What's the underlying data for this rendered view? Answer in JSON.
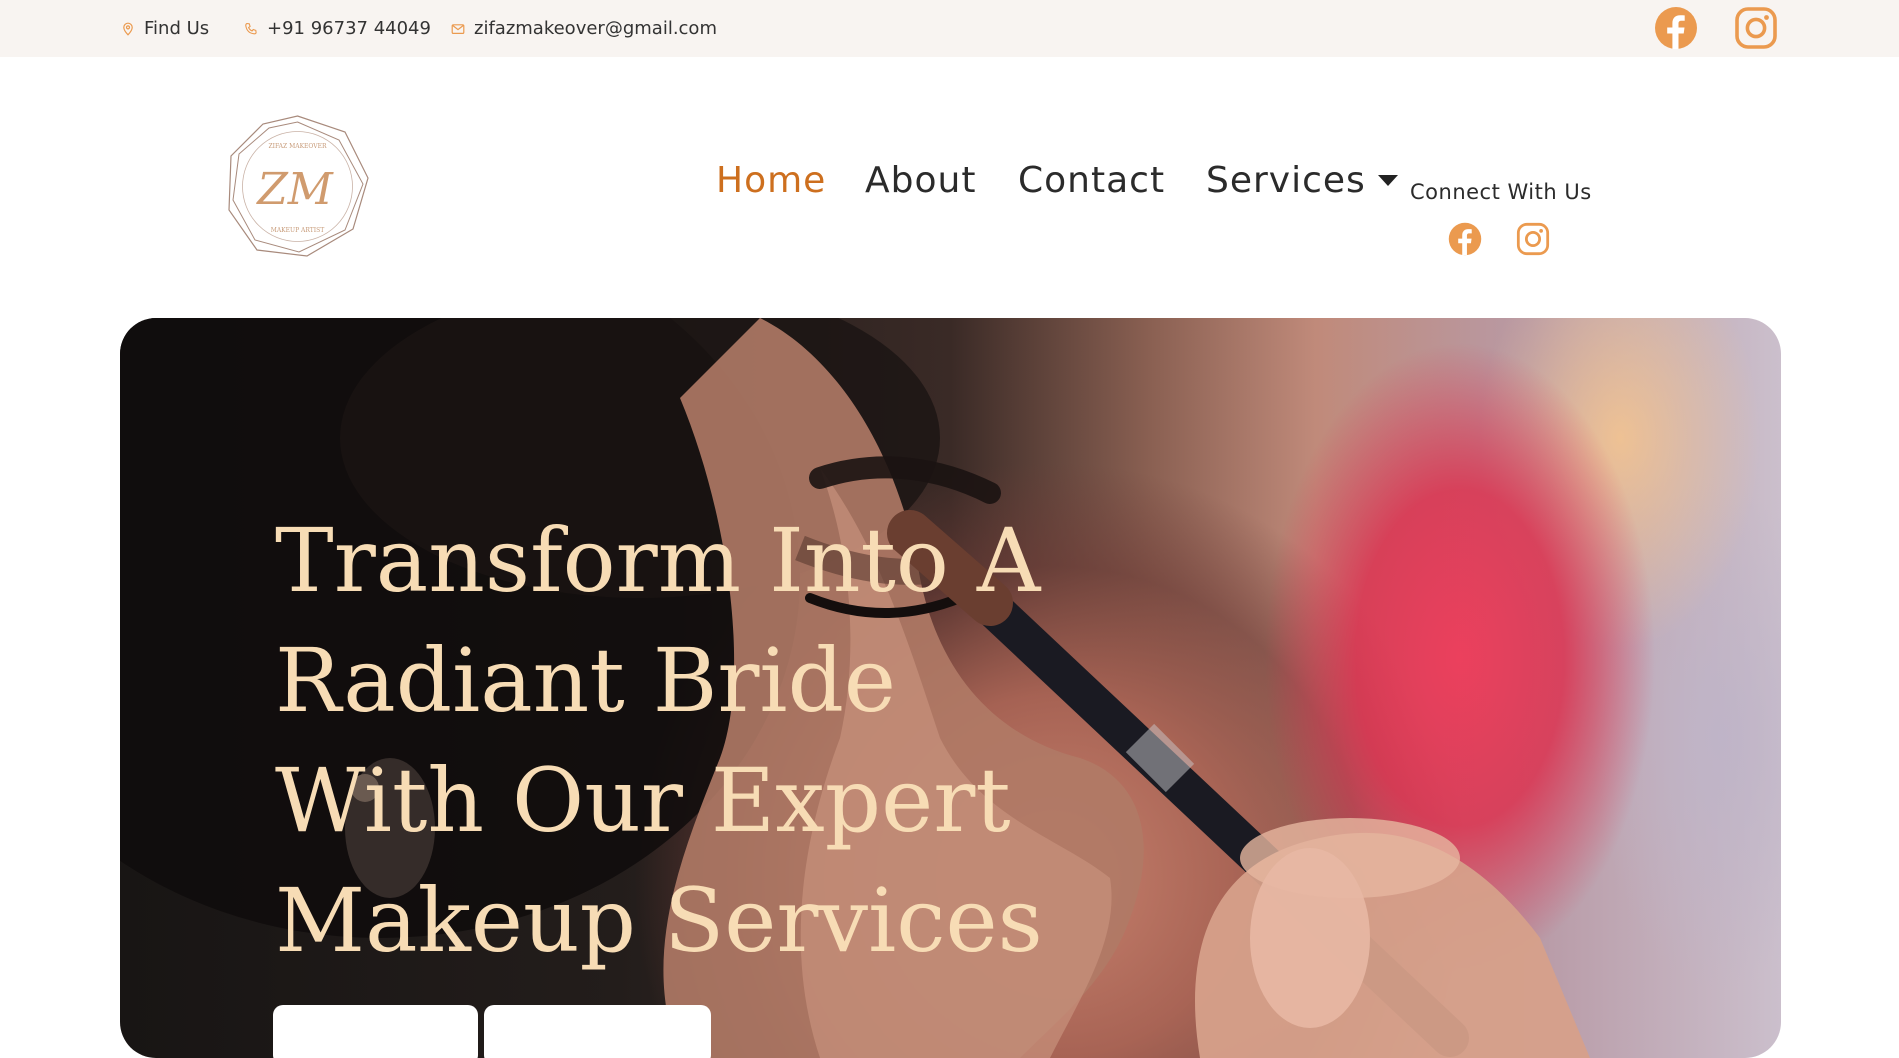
{
  "topbar": {
    "find_us": "Find Us",
    "phone": "+91 96737 44049",
    "email": "zifazmakeover@gmail.com",
    "icons": [
      "location-pin-icon",
      "phone-icon",
      "mail-icon",
      "facebook-icon",
      "instagram-icon"
    ]
  },
  "brand": {
    "logo_letters": "ZM",
    "logo_ring_text_top": "ZIFAZ MAKEOVER",
    "logo_ring_text_bottom": "MAKEUP ARTIST"
  },
  "nav": {
    "items": [
      {
        "label": "Home",
        "active": true
      },
      {
        "label": "About",
        "active": false
      },
      {
        "label": "Contact",
        "active": false
      },
      {
        "label": "Services",
        "active": false,
        "has_dropdown": true
      }
    ],
    "connect_label": "Connect With Us"
  },
  "hero": {
    "title": "Transform Into A Radiant Bride With Our Expert Makeup Services"
  },
  "colors": {
    "accent": "#cd6f1e",
    "icon_orange": "#eb9a4f",
    "topbar_bg": "#f8f4f1",
    "hero_title": "#f7dcb5",
    "logo_line": "#a88a7c"
  }
}
